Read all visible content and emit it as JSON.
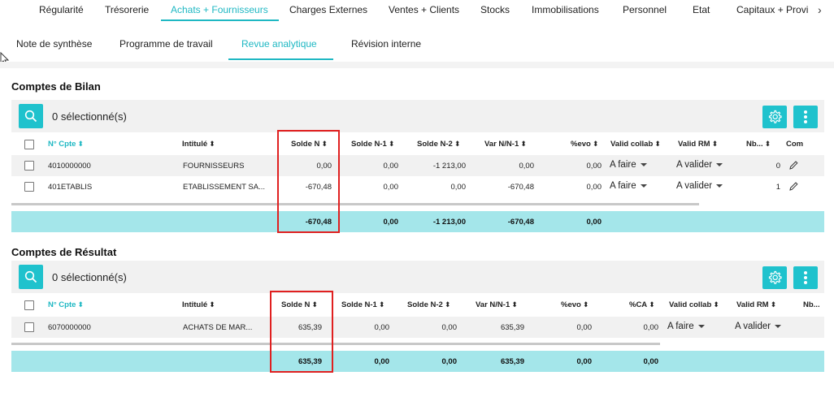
{
  "top_tabs": [
    "Régularité",
    "Trésorerie",
    "Achats + Fournisseurs",
    "Charges Externes",
    "Ventes + Clients",
    "Stocks",
    "Immobilisations",
    "Personnel",
    "Etat",
    "Capitaux + Provi"
  ],
  "top_tabs_more": "›",
  "sub_tabs": [
    "Note de synthèse",
    "Programme de travail",
    "Revue analytique",
    "Révision interne"
  ],
  "bilan": {
    "title": "Comptes de Bilan",
    "selected": "0 sélectionné(s)",
    "headers": {
      "num": "N° Cpte",
      "intitule": "Intitulé",
      "solde_n": "Solde N",
      "solde_n1": "Solde N-1",
      "solde_n2": "Solde N-2",
      "var": "Var N/N-1",
      "evo": "%evo",
      "valid_collab": "Valid collab",
      "valid_rm": "Valid RM",
      "nb": "Nb...",
      "com": "Com"
    },
    "rows": [
      {
        "num": "4010000000",
        "intitule": "FOURNISSEURS",
        "solde_n": "0,00",
        "solde_n1": "0,00",
        "solde_n2": "-1 213,00",
        "var": "0,00",
        "evo": "0,00",
        "valid_collab": "A faire",
        "valid_rm": "A valider",
        "nb": "0"
      },
      {
        "num": "401ETABLIS",
        "intitule": "ETABLISSEMENT SA...",
        "solde_n": "-670,48",
        "solde_n1": "0,00",
        "solde_n2": "0,00",
        "var": "-670,48",
        "evo": "0,00",
        "valid_collab": "A faire",
        "valid_rm": "A valider",
        "nb": "1"
      }
    ],
    "totals": {
      "solde_n": "-670,48",
      "solde_n1": "0,00",
      "solde_n2": "-1 213,00",
      "var": "-670,48",
      "evo": "0,00"
    }
  },
  "resultat": {
    "title": "Comptes de Résultat",
    "selected": "0 sélectionné(s)",
    "headers": {
      "num": "N° Cpte",
      "intitule": "Intitulé",
      "solde_n": "Solde N",
      "solde_n1": "Solde N-1",
      "solde_n2": "Solde N-2",
      "var": "Var N/N-1",
      "evo": "%evo",
      "ca": "%CA",
      "valid_collab": "Valid collab",
      "valid_rm": "Valid RM",
      "nb": "Nb..."
    },
    "rows": [
      {
        "num": "6070000000",
        "intitule": "ACHATS DE MAR...",
        "solde_n": "635,39",
        "solde_n1": "0,00",
        "solde_n2": "0,00",
        "var": "635,39",
        "evo": "0,00",
        "ca": "0,00",
        "valid_collab": "A faire",
        "valid_rm": "A valider"
      }
    ],
    "totals": {
      "solde_n": "635,39",
      "solde_n1": "0,00",
      "solde_n2": "0,00",
      "var": "635,39",
      "evo": "0,00",
      "ca": "0,00"
    }
  },
  "sort_glyph": "⬍",
  "colors": {
    "accent": "#1fc2cd",
    "total_bg": "#a4e6ea",
    "highlight_box": "#e02020"
  }
}
